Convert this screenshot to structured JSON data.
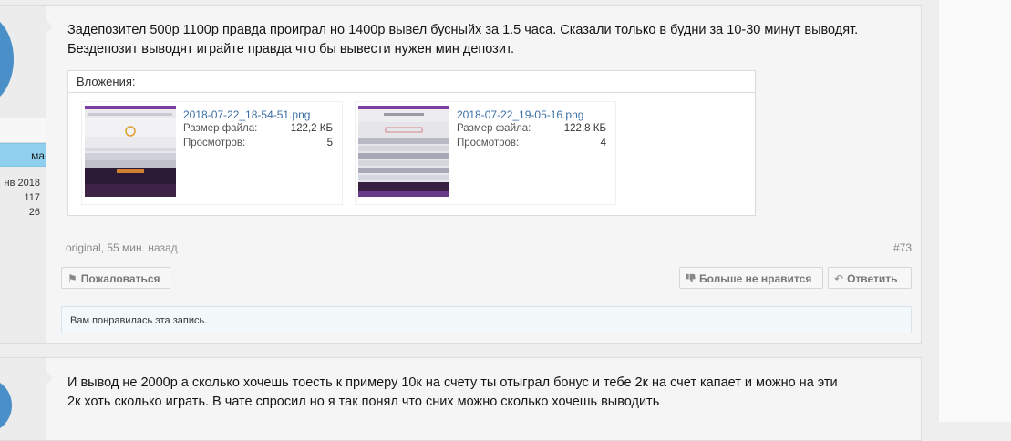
{
  "colors": {
    "page_bg": "#eeeeee",
    "post_bg": "#f5f5f5",
    "link": "#3b6ea5",
    "rank_badge": "#8fd0ef",
    "avatar": "#4a8fc8",
    "muted_text": "#888888"
  },
  "post1": {
    "user": {
      "rank": "ма",
      "stats": [
        "нв 2018",
        "117",
        "26"
      ]
    },
    "message": "Задепозител 500р 1100р правда проиграл но 1400р вывел бусныйх за 1.5 часа. Сказали только в будни за 10-30 минут выводят.\nБездепозит выводят играйте правда что бы вывести нужен мин депозит.",
    "attachments_label": "Вложения:",
    "attachments": [
      {
        "filename": "2018-07-22_18-54-51.png",
        "size_label": "Размер файла:",
        "size": "122,2 КБ",
        "views_label": "Просмотров:",
        "views": "5"
      },
      {
        "filename": "2018-07-22_19-05-16.png",
        "size_label": "Размер файла:",
        "size": "122,8 КБ",
        "views_label": "Просмотров:",
        "views": "4"
      }
    ],
    "meta": "original, 55 мин. назад",
    "number": "#73",
    "buttons": {
      "report": "Пожаловаться",
      "unlike": "Больше не нравится",
      "reply": "Ответить"
    },
    "likes_text": "Вам понравилась эта запись."
  },
  "post2": {
    "message": "И вывод не 2000р а сколько хочешь тоесть к примеру 10к на счету ты отыграл бонус и тебе 2к на счет капает и можно на эти\n2к хоть сколько играть. В чате спросил но я так понял что сних можно сколько хочешь выводить"
  },
  "icons": {
    "report": "flag-icon",
    "unlike": "thumbs-down-icon",
    "reply": "reply-arrow-icon"
  }
}
